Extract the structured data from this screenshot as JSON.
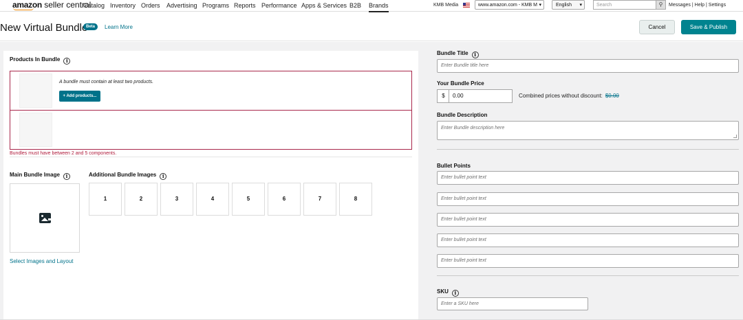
{
  "brand": {
    "logo_bold": "amazon",
    "logo_rest": " seller central"
  },
  "nav": {
    "items": [
      "Catalog",
      "Inventory",
      "Orders",
      "Advertising",
      "Programs",
      "Reports",
      "Performance",
      "Apps & Services",
      "B2B",
      "Brands"
    ],
    "active": "Brands"
  },
  "header_right": {
    "store_name": "KMB Media",
    "marketplace": "www.amazon.com - KMB M",
    "language": "English",
    "search_placeholder": "Search",
    "messages": "Messages",
    "help": "Help",
    "settings": "Settings",
    "separator": "|"
  },
  "page": {
    "title": "New Virtual Bundle",
    "beta_badge": "Beta",
    "learn_more": "Learn More",
    "cancel": "Cancel",
    "save_publish": "Save & Publish"
  },
  "products": {
    "title": "Products In Bundle",
    "hint": "A bundle must contain at least two products.",
    "add_button": "+ Add products...",
    "error": "Bundles must have between 2 and 5 components."
  },
  "images": {
    "main_title": "Main Bundle Image",
    "additional_title": "Additional Bundle Images",
    "slots": [
      "1",
      "2",
      "3",
      "4",
      "5",
      "6",
      "7",
      "8"
    ],
    "select_link": "Select Images and Layout"
  },
  "form": {
    "bundle_title_label": "Bundle Title",
    "bundle_title_placeholder": "Enter Bundle title here",
    "price_label": "Your Bundle Price",
    "currency": "$",
    "price_value": "0.00",
    "combined_label": "Combined prices without discount:",
    "combined_value": "$0.00",
    "description_label": "Bundle Description",
    "description_placeholder": "Enter Bundle description here",
    "bullets_label": "Bullet Points",
    "bullet_placeholders": [
      "Enter bullet point text",
      "Enter bullet point text",
      "Enter bullet point text",
      "Enter bullet point text",
      "Enter bullet point text"
    ],
    "sku_label": "SKU",
    "sku_placeholder": "Enter a SKU here"
  },
  "info_glyph": "i",
  "icons": {
    "search": "search-icon",
    "info": "info-icon",
    "image": "image-icon",
    "caret": "chevron-down-icon"
  }
}
